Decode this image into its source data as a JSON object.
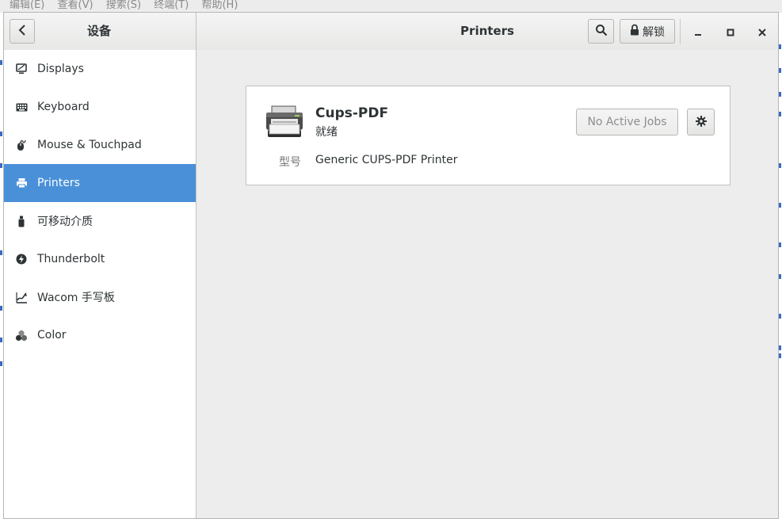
{
  "background": {
    "menubar_items": [
      "编辑(E)",
      "查看(V)",
      "搜索(S)",
      "终端(T)",
      "帮助(H)"
    ]
  },
  "header": {
    "sidebar_title": "设备",
    "main_title": "Printers",
    "unlock_label": "解锁",
    "icons": {
      "back": "chevron-left-icon",
      "search": "search-icon",
      "lock": "lock-icon",
      "minimize": "minimize-icon",
      "maximize": "maximize-icon",
      "close": "close-icon"
    }
  },
  "sidebar": {
    "items": [
      {
        "label": "Displays",
        "icon": "display-icon"
      },
      {
        "label": "Keyboard",
        "icon": "keyboard-icon"
      },
      {
        "label": "Mouse & Touchpad",
        "icon": "mouse-icon"
      },
      {
        "label": "Printers",
        "icon": "printer-icon",
        "active": true
      },
      {
        "label": "可移动介质",
        "icon": "removable-media-icon"
      },
      {
        "label": "Thunderbolt",
        "icon": "thunderbolt-icon"
      },
      {
        "label": "Wacom 手写板",
        "icon": "tablet-icon"
      },
      {
        "label": "Color",
        "icon": "color-icon"
      }
    ]
  },
  "printer": {
    "name": "Cups-PDF",
    "status": "就绪",
    "model_label": "型号",
    "model": "Generic CUPS-PDF Printer",
    "jobs_button": "No Active Jobs",
    "settings_icon": "gear-icon",
    "image_icon": "printer-image-icon"
  },
  "colors": {
    "accent": "#4a90d9",
    "content_bg": "#ededed"
  }
}
